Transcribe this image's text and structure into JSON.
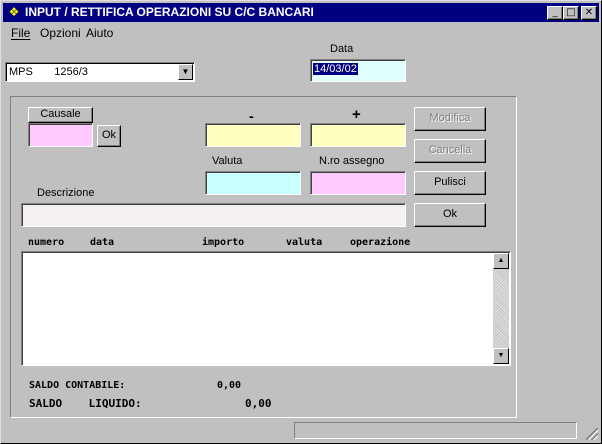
{
  "window": {
    "title": "INPUT / RETTIFICA OPERAZIONI SU C/C BANCARI",
    "minimize": "_",
    "maximize": "□",
    "close": "✕"
  },
  "menu": {
    "file": "File",
    "opzioni": "Opzioni",
    "aiuto": "Aiuto"
  },
  "account_select": {
    "value": "MPS       1256/3"
  },
  "date": {
    "label": "Data",
    "value": "14/03/02"
  },
  "form": {
    "causale_label": "Causale",
    "causale_ok": "Ok",
    "minus_label": "-",
    "plus_label": "+",
    "valuta_label": "Valuta",
    "assegno_label": "N.ro assegno",
    "descrizione_label": "Descrizione"
  },
  "buttons": {
    "modifica": "Modifica",
    "cancella": "Cancella",
    "pulisci": "Pulisci",
    "ok": "Ok"
  },
  "list": {
    "headers": [
      "numero",
      "data",
      "importo",
      "valuta",
      "operazione"
    ]
  },
  "summary": {
    "saldo_contabile_label": "SALDO CONTABILE:",
    "saldo_contabile_value": "0,00",
    "saldo_liquido_label": "SALDO    LIQUIDO:",
    "saldo_liquido_value": "0,00"
  },
  "colors": {
    "titlebar": "#000080",
    "causale_bg": "#ffc8ff",
    "amount_bg": "#ffffc0",
    "valuta_bg": "#c8ffff"
  }
}
